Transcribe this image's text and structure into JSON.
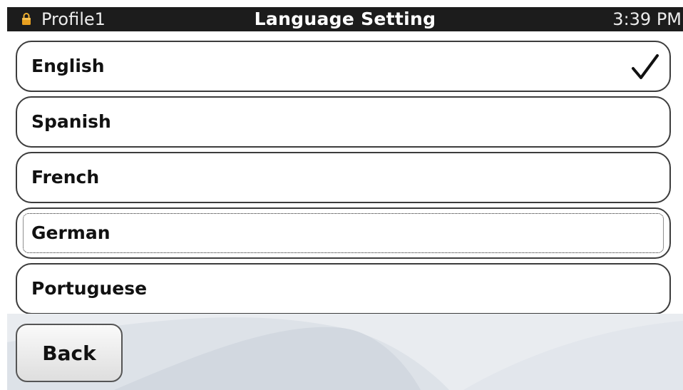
{
  "status_bar": {
    "profile": "Profile1",
    "title": "Language Setting",
    "time": "3:39 PM",
    "lock_icon": "lock-icon",
    "lock_color": "#e8a020"
  },
  "languages": [
    {
      "label": "English",
      "selected": true,
      "focused": false
    },
    {
      "label": "Spanish",
      "selected": false,
      "focused": false
    },
    {
      "label": "French",
      "selected": false,
      "focused": false
    },
    {
      "label": "German",
      "selected": false,
      "focused": true
    },
    {
      "label": "Portuguese",
      "selected": false,
      "focused": false
    }
  ],
  "selected_icon": "checkmark-icon",
  "back_button": {
    "label": "Back"
  }
}
